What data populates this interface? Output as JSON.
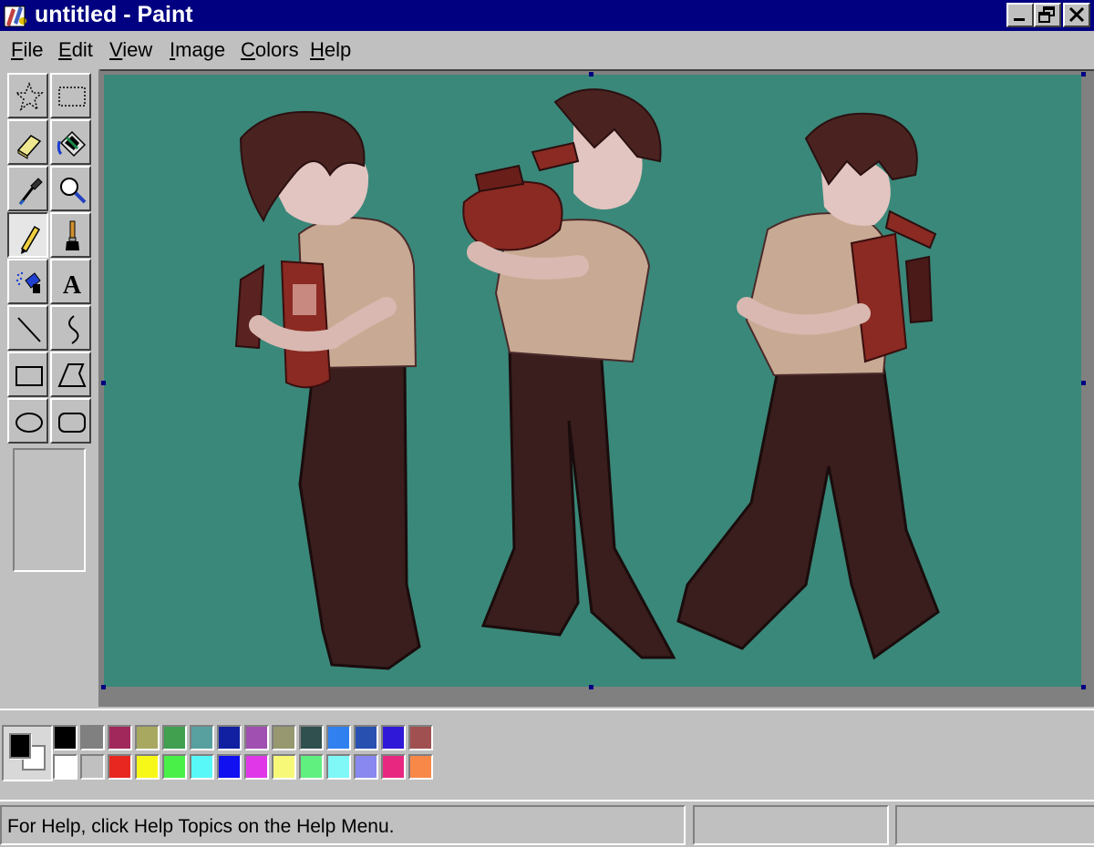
{
  "window": {
    "title": "untitled - Paint",
    "controls": [
      "minimize-icon",
      "restore-icon",
      "close-icon"
    ]
  },
  "menubar": {
    "items": [
      {
        "label": "File"
      },
      {
        "label": "Edit"
      },
      {
        "label": "View"
      },
      {
        "label": "Image"
      },
      {
        "label": "Colors"
      },
      {
        "label": "Help"
      }
    ]
  },
  "toolbox": {
    "tools": [
      {
        "name": "free-form-select",
        "icon": "star-select-icon"
      },
      {
        "name": "select",
        "icon": "rect-select-icon"
      },
      {
        "name": "eraser",
        "icon": "eraser-icon"
      },
      {
        "name": "fill-with-color",
        "icon": "paint-bucket-icon"
      },
      {
        "name": "pick-color",
        "icon": "eyedropper-icon"
      },
      {
        "name": "magnifier",
        "icon": "magnifier-icon"
      },
      {
        "name": "pencil",
        "icon": "pencil-icon",
        "selected": true
      },
      {
        "name": "brush",
        "icon": "brush-icon"
      },
      {
        "name": "airbrush",
        "icon": "airbrush-icon"
      },
      {
        "name": "text",
        "icon": "text-icon",
        "glyph": "A"
      },
      {
        "name": "line",
        "icon": "line-icon"
      },
      {
        "name": "curve",
        "icon": "curve-icon"
      },
      {
        "name": "rectangle",
        "icon": "rectangle-icon"
      },
      {
        "name": "polygon",
        "icon": "polygon-icon"
      },
      {
        "name": "ellipse",
        "icon": "ellipse-icon"
      },
      {
        "name": "rounded-rectangle",
        "icon": "rounded-rect-icon"
      }
    ]
  },
  "canvas": {
    "background": "#3a887a",
    "artwork": "three-figures-with-fire-extinguisher"
  },
  "palette": {
    "foreground": "#000000",
    "background": "#ffffff",
    "top_row": [
      "#000000",
      "#808080",
      "#a0285a",
      "#a8a860",
      "#40a050",
      "#58a0a0",
      "#1020a0",
      "#a050b0",
      "#989870",
      "#305050",
      "#3080f0",
      "#2850b0",
      "#3018d8",
      "#a05050"
    ],
    "bottom_row": [
      "#ffffff",
      "#c0c0c0",
      "#e82820",
      "#f8f818",
      "#48f048",
      "#58f8f8",
      "#1010f0",
      "#e038e8",
      "#f8f878",
      "#60f080",
      "#80f8f8",
      "#8888f0",
      "#e82880",
      "#f88848"
    ]
  },
  "status": {
    "text": "For Help, click Help Topics on the Help Menu.",
    "pane2": "",
    "pane3": ""
  }
}
